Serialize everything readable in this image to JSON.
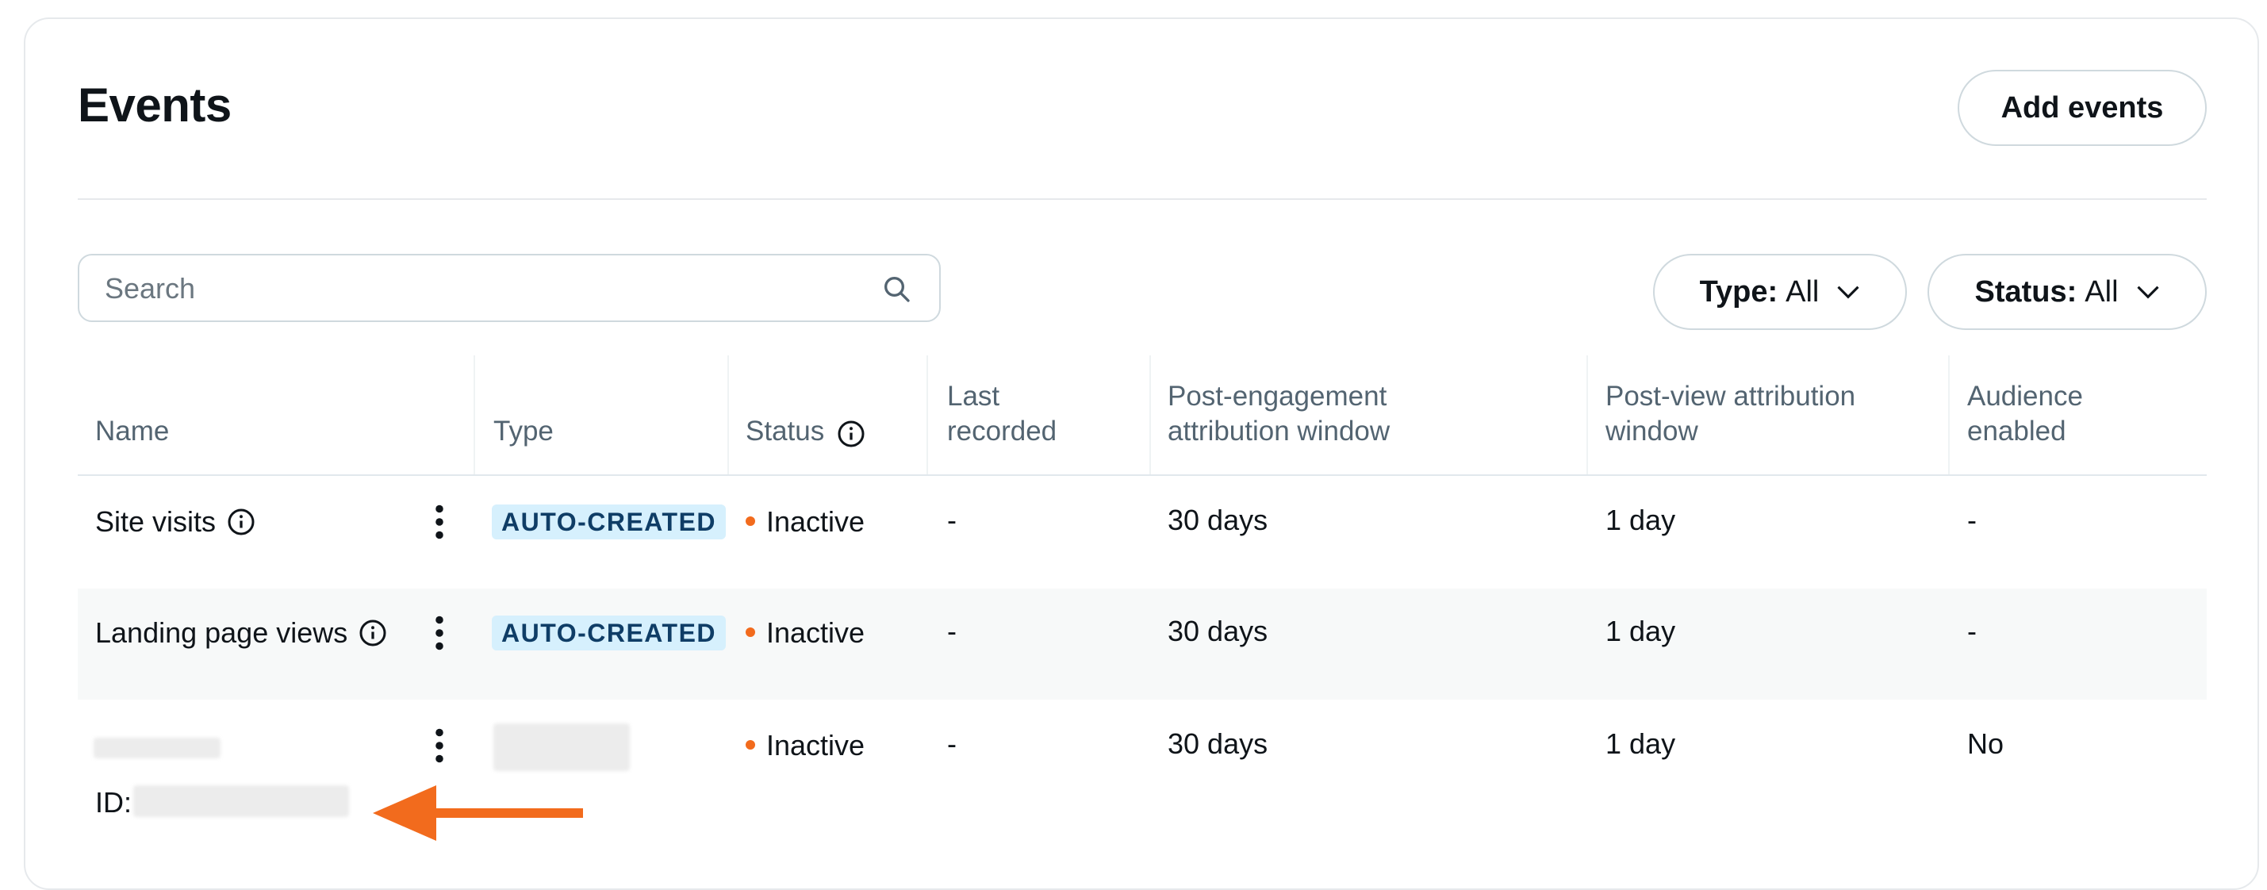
{
  "header": {
    "title": "Events",
    "add_button": "Add events"
  },
  "search": {
    "placeholder": "Search"
  },
  "filters": {
    "type_label": "Type:",
    "type_value": "All",
    "status_label": "Status:",
    "status_value": "All"
  },
  "columns": {
    "name": "Name",
    "type": "Type",
    "status": "Status",
    "last_recorded": [
      "Last",
      "recorded"
    ],
    "post_engagement": [
      "Post-engagement",
      "attribution window"
    ],
    "post_view": [
      "Post-view attribution",
      "window"
    ],
    "audience": [
      "Audience",
      "enabled"
    ]
  },
  "rows": [
    {
      "name": "Site visits",
      "type": "AUTO-CREATED",
      "status": "Inactive",
      "last_recorded": "-",
      "post_engagement": "30 days",
      "post_view": "1 day",
      "audience": "-"
    },
    {
      "name": "Landing page views",
      "type": "AUTO-CREATED",
      "status": "Inactive",
      "last_recorded": "-",
      "post_engagement": "30 days",
      "post_view": "1 day",
      "audience": "-"
    },
    {
      "name": "",
      "id_label": "ID:",
      "type": "",
      "status": "Inactive",
      "last_recorded": "-",
      "post_engagement": "30 days",
      "post_view": "1 day",
      "audience": "No"
    }
  ],
  "colors": {
    "accent_orange": "#f26b1d",
    "badge_bg": "#d6f0fd",
    "badge_text": "#0f3d66",
    "border": "#cfd9de"
  },
  "icons": [
    "search-icon",
    "chevron-down-icon",
    "info-icon",
    "kebab-menu-icon",
    "arrow-left-icon"
  ]
}
